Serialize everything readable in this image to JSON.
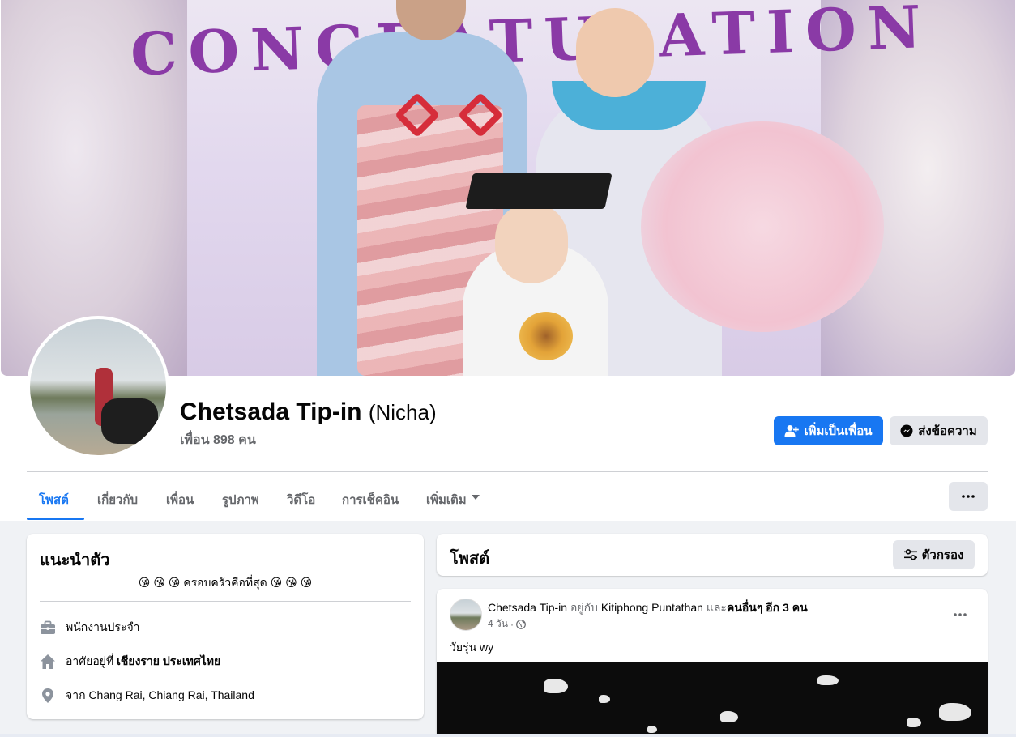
{
  "profile": {
    "name": "Chetsada Tip-in",
    "alternate_name": "(Nicha)",
    "friend_count": "เพื่อน 898 คน"
  },
  "actions": {
    "add_friend_label": "เพิ่มเป็นเพื่อน",
    "message_label": "ส่งข้อความ"
  },
  "cover": {
    "banner_text": "CONGRATULATION"
  },
  "tabs": [
    {
      "label": "โพสต์",
      "active": true
    },
    {
      "label": "เกี่ยวกับ",
      "active": false
    },
    {
      "label": "เพื่อน",
      "active": false
    },
    {
      "label": "รูปภาพ",
      "active": false
    },
    {
      "label": "วิดีโอ",
      "active": false
    },
    {
      "label": "การเช็คอิน",
      "active": false
    },
    {
      "label": "เพิ่มเติม",
      "active": false
    }
  ],
  "intro": {
    "title": "แนะนำตัว",
    "bio": "😘 😘 😘 ครอบครัวคือที่สุด 😘 😘 😘",
    "work": "พนักงานประจำ",
    "lives_prefix": "อาศัยอยู่ที่ ",
    "lives_place": "เชียงราย ประเทศไทย",
    "from_prefix": "จาก ",
    "from_place": "Chang Rai, Chiang Rai, Thailand"
  },
  "posts": {
    "title": "โพสต์",
    "filter_label": "ตัวกรอง"
  },
  "post": {
    "author": "Chetsada Tip-in",
    "with_text": " อยู่กับ ",
    "tagged": "Kitiphong Puntathan",
    "and_text": " และ",
    "others": "คนอื่นๆ อีก 3 คน",
    "time": "4 วัน",
    "separator": "·",
    "text": "วัยรุ่น    wy"
  },
  "colors": {
    "accent": "#1877f2",
    "page_bg": "#f0f2f5",
    "secondary_button": "#e4e6eb",
    "muted_text": "#65676b"
  }
}
